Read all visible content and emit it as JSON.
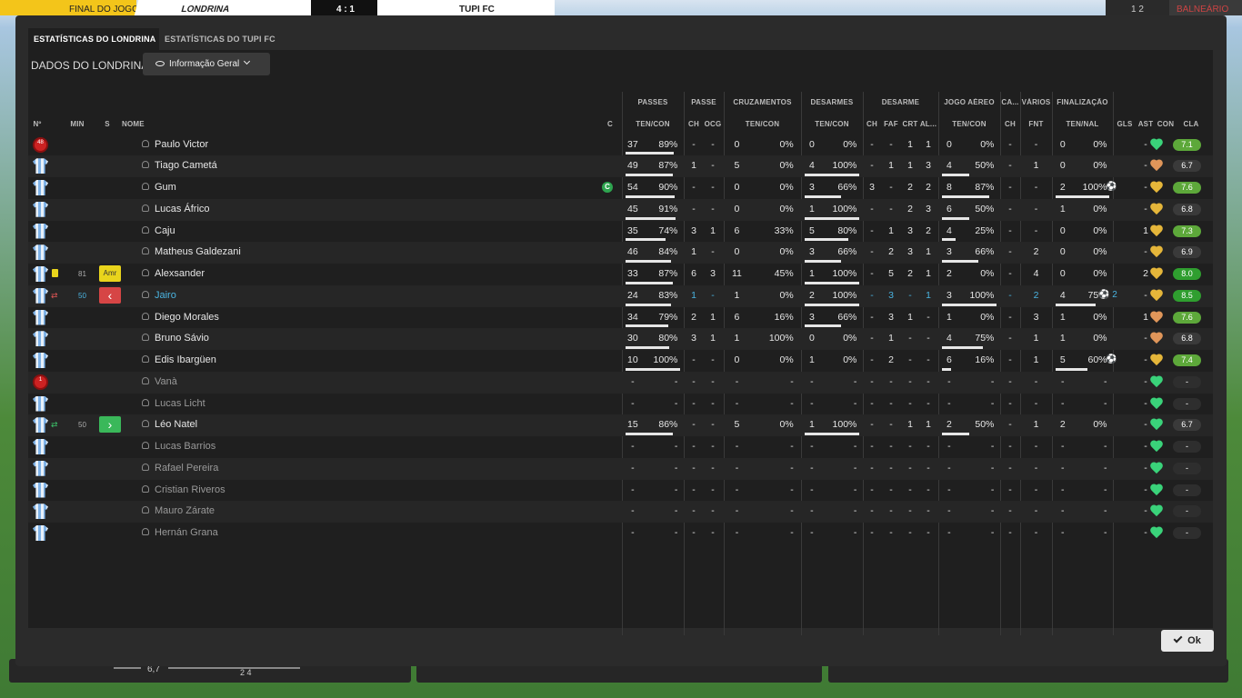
{
  "topbar": {
    "status": "FINAL DO JOGO",
    "home_team": "LONDRINA",
    "score": "4 : 1",
    "away_team": "TUPI FC",
    "controls": "1 2",
    "vestiario": "BALNEÁRIO"
  },
  "underlay": {
    "rating": "6,7",
    "value": "2 4"
  },
  "tabs": [
    {
      "label": "ESTATÍSTICAS DO LONDRINA",
      "active": true
    },
    {
      "label": "ESTATÍSTICAS DO TUPI FC",
      "active": false
    }
  ],
  "toolbar": {
    "label": "DADOS DO LONDRINA",
    "view": "Informação Geral"
  },
  "groups": [
    "PASSES",
    "PASSE",
    "CRUZAMENTOS",
    "DESARMES",
    "DESARME",
    "JOGO AÉREO",
    "CA...",
    "VÁRIOS",
    "FINALIZAÇÃO"
  ],
  "columns": {
    "num": "Nº",
    "min": "MIN",
    "s": "S",
    "name": "NOME",
    "c": "C",
    "passes": "TEN/CON",
    "pch": "CH",
    "pocg": "OCG",
    "cross": "TEN/CON",
    "tackles": "TEN/CON",
    "dch": "CH",
    "faf": "FAF",
    "crt": "CRT",
    "al": "AL...",
    "air": "TEN/CON",
    "cach": "CH",
    "fnt": "FNT",
    "shots": "TEN/NAL",
    "gls": "GLS",
    "ast": "AST",
    "con": "CON",
    "cla": "CLA"
  },
  "colors": {
    "rating_high": "#5da83a",
    "rating_top": "#2f9e2f",
    "rating_neutral": "#3a3a3a",
    "heart_green": "#3ad37a",
    "heart_gold": "#e5b63a",
    "heart_orange": "#e0965a",
    "link_blue": "#4ab3e0"
  },
  "players": [
    {
      "shirt": "gk",
      "num": "48",
      "name": "Paulo Victor",
      "cap": "",
      "pass": [
        "37",
        "89%"
      ],
      "pch": "-",
      "pocg": "-",
      "cross": [
        "0",
        "0%"
      ],
      "tack": [
        "0",
        "0%"
      ],
      "dch": "-",
      "faf": "-",
      "crt": "1",
      "al": "1",
      "air": [
        "0",
        "0%"
      ],
      "cach": "-",
      "fnt": "-",
      "shot": [
        "0",
        "0%"
      ],
      "gls": "",
      "ast": "-",
      "con": "green",
      "cla": "7.1",
      "cla_c": "green",
      "pass_fill": 0.89,
      "tack_fill": 0,
      "air_fill": 0,
      "shot_fill": 0
    },
    {
      "shirt": "out",
      "num": "",
      "name": "Tiago Cametá",
      "cap": "",
      "pass": [
        "49",
        "87%"
      ],
      "pch": "1",
      "pocg": "-",
      "cross": [
        "5",
        "0%"
      ],
      "tack": [
        "4",
        "100%"
      ],
      "dch": "-",
      "faf": "1",
      "crt": "1",
      "al": "3",
      "air": [
        "4",
        "50%"
      ],
      "cach": "-",
      "fnt": "1",
      "shot": [
        "0",
        "0%"
      ],
      "gls": "",
      "ast": "-",
      "con": "orange",
      "cla": "6.7",
      "cla_c": "neutral",
      "pass_fill": 0.87,
      "tack_fill": 1,
      "air_fill": 0.5,
      "shot_fill": 0
    },
    {
      "shirt": "out",
      "num": "",
      "name": "Gum",
      "cap": "C",
      "pass": [
        "54",
        "90%"
      ],
      "pch": "-",
      "pocg": "-",
      "cross": [
        "0",
        "0%"
      ],
      "tack": [
        "3",
        "66%"
      ],
      "dch": "3",
      "faf": "-",
      "crt": "2",
      "al": "2",
      "air": [
        "8",
        "87%"
      ],
      "cach": "-",
      "fnt": "-",
      "shot": [
        "2",
        "100%"
      ],
      "gls": "ball",
      "ast": "-",
      "con": "gold",
      "cla": "7.6",
      "cla_c": "green",
      "pass_fill": 0.9,
      "tack_fill": 0.66,
      "air_fill": 0.87,
      "shot_fill": 1
    },
    {
      "shirt": "out",
      "num": "",
      "name": "Lucas Áfrico",
      "cap": "",
      "pass": [
        "45",
        "91%"
      ],
      "pch": "-",
      "pocg": "-",
      "cross": [
        "0",
        "0%"
      ],
      "tack": [
        "1",
        "100%"
      ],
      "dch": "-",
      "faf": "-",
      "crt": "2",
      "al": "3",
      "air": [
        "6",
        "50%"
      ],
      "cach": "-",
      "fnt": "-",
      "shot": [
        "1",
        "0%"
      ],
      "gls": "",
      "ast": "-",
      "con": "gold",
      "cla": "6.8",
      "cla_c": "neutral",
      "pass_fill": 0.91,
      "tack_fill": 1,
      "air_fill": 0.5,
      "shot_fill": 0
    },
    {
      "shirt": "out",
      "num": "",
      "name": "Caju",
      "cap": "",
      "pass": [
        "35",
        "74%"
      ],
      "pch": "3",
      "pocg": "1",
      "cross": [
        "6",
        "33%"
      ],
      "tack": [
        "5",
        "80%"
      ],
      "dch": "-",
      "faf": "1",
      "crt": "3",
      "al": "2",
      "air": [
        "4",
        "25%"
      ],
      "cach": "-",
      "fnt": "-",
      "shot": [
        "0",
        "0%"
      ],
      "gls": "",
      "ast": "1",
      "con": "gold",
      "cla": "7.3",
      "cla_c": "green",
      "pass_fill": 0.74,
      "tack_fill": 0.8,
      "air_fill": 0.25,
      "shot_fill": 0
    },
    {
      "shirt": "out",
      "num": "",
      "name": "Matheus Galdezani",
      "cap": "",
      "pass": [
        "46",
        "84%"
      ],
      "pch": "1",
      "pocg": "-",
      "cross": [
        "0",
        "0%"
      ],
      "tack": [
        "3",
        "66%"
      ],
      "dch": "-",
      "faf": "2",
      "crt": "3",
      "al": "1",
      "air": [
        "3",
        "66%"
      ],
      "cach": "-",
      "fnt": "2",
      "shot": [
        "0",
        "0%"
      ],
      "gls": "",
      "ast": "-",
      "con": "gold",
      "cla": "6.9",
      "cla_c": "neutral",
      "pass_fill": 0.84,
      "tack_fill": 0.66,
      "air_fill": 0.66,
      "shot_fill": 0
    },
    {
      "shirt": "out",
      "num": "",
      "name": "Alexsander",
      "cap": "",
      "card": "yellow",
      "min": "81",
      "badge": "Amr",
      "pass": [
        "33",
        "87%"
      ],
      "pch": "6",
      "pocg": "3",
      "cross": [
        "11",
        "45%"
      ],
      "tack": [
        "1",
        "100%"
      ],
      "dch": "-",
      "faf": "5",
      "crt": "2",
      "al": "1",
      "air": [
        "2",
        "0%"
      ],
      "cach": "-",
      "fnt": "4",
      "shot": [
        "0",
        "0%"
      ],
      "gls": "",
      "ast": "2",
      "con": "gold",
      "cla": "8.0",
      "cla_c": "top",
      "pass_fill": 0.87,
      "tack_fill": 1,
      "air_fill": 0,
      "shot_fill": 0
    },
    {
      "shirt": "out",
      "num": "",
      "name": "Jairo",
      "cap": "",
      "sub": "off",
      "min": "50",
      "badge": "‹",
      "hl": true,
      "pass": [
        "24",
        "83%"
      ],
      "pch": "1",
      "pocg": "-",
      "cross": [
        "1",
        "0%"
      ],
      "tack": [
        "2",
        "100%"
      ],
      "dch": "-",
      "faf": "3",
      "crt": "-",
      "al": "1",
      "air": [
        "3",
        "100%"
      ],
      "cach": "-",
      "fnt": "2",
      "shot": [
        "4",
        "75%"
      ],
      "gls": "ball2",
      "ast": "-",
      "con": "gold",
      "cla": "8.5",
      "cla_c": "top",
      "pass_fill": 0.83,
      "tack_fill": 1,
      "air_fill": 1,
      "shot_fill": 0.75
    },
    {
      "shirt": "out",
      "num": "",
      "name": "Diego Morales",
      "cap": "",
      "pass": [
        "34",
        "79%"
      ],
      "pch": "2",
      "pocg": "1",
      "cross": [
        "6",
        "16%"
      ],
      "tack": [
        "3",
        "66%"
      ],
      "dch": "-",
      "faf": "3",
      "crt": "1",
      "al": "-",
      "air": [
        "1",
        "0%"
      ],
      "cach": "-",
      "fnt": "3",
      "shot": [
        "1",
        "0%"
      ],
      "gls": "",
      "ast": "1",
      "con": "orange",
      "cla": "7.6",
      "cla_c": "green",
      "pass_fill": 0.79,
      "tack_fill": 0.66,
      "air_fill": 0,
      "shot_fill": 0
    },
    {
      "shirt": "out",
      "num": "",
      "name": "Bruno Sávio",
      "cap": "",
      "pass": [
        "30",
        "80%"
      ],
      "pch": "3",
      "pocg": "1",
      "cross": [
        "1",
        "100%"
      ],
      "tack": [
        "0",
        "0%"
      ],
      "dch": "-",
      "faf": "1",
      "crt": "-",
      "al": "-",
      "air": [
        "4",
        "75%"
      ],
      "cach": "-",
      "fnt": "1",
      "shot": [
        "1",
        "0%"
      ],
      "gls": "",
      "ast": "-",
      "con": "orange",
      "cla": "6.8",
      "cla_c": "neutral",
      "pass_fill": 0.8,
      "tack_fill": 0,
      "air_fill": 0.75,
      "shot_fill": 0
    },
    {
      "shirt": "out",
      "num": "",
      "name": "Edis Ibargüen",
      "cap": "",
      "pass": [
        "10",
        "100%"
      ],
      "pch": "-",
      "pocg": "-",
      "cross": [
        "0",
        "0%"
      ],
      "tack": [
        "1",
        "0%"
      ],
      "dch": "-",
      "faf": "2",
      "crt": "-",
      "al": "-",
      "air": [
        "6",
        "16%"
      ],
      "cach": "-",
      "fnt": "1",
      "shot": [
        "5",
        "60%"
      ],
      "gls": "ball",
      "ast": "-",
      "con": "gold",
      "cla": "7.4",
      "cla_c": "green",
      "pass_fill": 1,
      "tack_fill": 0,
      "air_fill": 0.16,
      "shot_fill": 0.6
    },
    {
      "shirt": "gk",
      "num": "1",
      "name": "Vanà",
      "cap": "",
      "dim": true,
      "pass": [
        "-",
        "-"
      ],
      "pch": "-",
      "pocg": "-",
      "cross": [
        "-",
        "-"
      ],
      "tack": [
        "-",
        "-"
      ],
      "dch": "-",
      "faf": "-",
      "crt": "-",
      "al": "-",
      "air": [
        "-",
        "-"
      ],
      "cach": "-",
      "fnt": "-",
      "shot": [
        "-",
        "-"
      ],
      "gls": "",
      "ast": "-",
      "con": "green",
      "cla": "-",
      "cla_c": "dark"
    },
    {
      "shirt": "out",
      "num": "",
      "name": "Lucas Licht",
      "cap": "",
      "dim": true,
      "pass": [
        "-",
        "-"
      ],
      "pch": "-",
      "pocg": "-",
      "cross": [
        "-",
        "-"
      ],
      "tack": [
        "-",
        "-"
      ],
      "dch": "-",
      "faf": "-",
      "crt": "-",
      "al": "-",
      "air": [
        "-",
        "-"
      ],
      "cach": "-",
      "fnt": "-",
      "shot": [
        "-",
        "-"
      ],
      "gls": "",
      "ast": "-",
      "con": "green",
      "cla": "-",
      "cla_c": "dark"
    },
    {
      "shirt": "out",
      "num": "",
      "name": "Léo Natel",
      "cap": "",
      "sub": "on",
      "min": "50",
      "badge": "›",
      "pass": [
        "15",
        "86%"
      ],
      "pch": "-",
      "pocg": "-",
      "cross": [
        "5",
        "0%"
      ],
      "tack": [
        "1",
        "100%"
      ],
      "dch": "-",
      "faf": "-",
      "crt": "1",
      "al": "1",
      "air": [
        "2",
        "50%"
      ],
      "cach": "-",
      "fnt": "1",
      "shot": [
        "2",
        "0%"
      ],
      "gls": "",
      "ast": "-",
      "con": "green",
      "cla": "6.7",
      "cla_c": "neutral",
      "pass_fill": 0.86,
      "tack_fill": 1,
      "air_fill": 0.5,
      "shot_fill": 0
    },
    {
      "shirt": "out",
      "num": "",
      "name": "Lucas Barrios",
      "cap": "",
      "dim": true,
      "pass": [
        "-",
        "-"
      ],
      "pch": "-",
      "pocg": "-",
      "cross": [
        "-",
        "-"
      ],
      "tack": [
        "-",
        "-"
      ],
      "dch": "-",
      "faf": "-",
      "crt": "-",
      "al": "-",
      "air": [
        "-",
        "-"
      ],
      "cach": "-",
      "fnt": "-",
      "shot": [
        "-",
        "-"
      ],
      "gls": "",
      "ast": "-",
      "con": "green",
      "cla": "-",
      "cla_c": "dark"
    },
    {
      "shirt": "out",
      "num": "",
      "name": "Rafael Pereira",
      "cap": "",
      "dim": true,
      "pass": [
        "-",
        "-"
      ],
      "pch": "-",
      "pocg": "-",
      "cross": [
        "-",
        "-"
      ],
      "tack": [
        "-",
        "-"
      ],
      "dch": "-",
      "faf": "-",
      "crt": "-",
      "al": "-",
      "air": [
        "-",
        "-"
      ],
      "cach": "-",
      "fnt": "-",
      "shot": [
        "-",
        "-"
      ],
      "gls": "",
      "ast": "-",
      "con": "green",
      "cla": "-",
      "cla_c": "dark"
    },
    {
      "shirt": "out",
      "num": "",
      "name": "Cristian Riveros",
      "cap": "",
      "dim": true,
      "pass": [
        "-",
        "-"
      ],
      "pch": "-",
      "pocg": "-",
      "cross": [
        "-",
        "-"
      ],
      "tack": [
        "-",
        "-"
      ],
      "dch": "-",
      "faf": "-",
      "crt": "-",
      "al": "-",
      "air": [
        "-",
        "-"
      ],
      "cach": "-",
      "fnt": "-",
      "shot": [
        "-",
        "-"
      ],
      "gls": "",
      "ast": "-",
      "con": "green",
      "cla": "-",
      "cla_c": "dark"
    },
    {
      "shirt": "out",
      "num": "",
      "name": "Mauro Zárate",
      "cap": "",
      "dim": true,
      "pass": [
        "-",
        "-"
      ],
      "pch": "-",
      "pocg": "-",
      "cross": [
        "-",
        "-"
      ],
      "tack": [
        "-",
        "-"
      ],
      "dch": "-",
      "faf": "-",
      "crt": "-",
      "al": "-",
      "air": [
        "-",
        "-"
      ],
      "cach": "-",
      "fnt": "-",
      "shot": [
        "-",
        "-"
      ],
      "gls": "",
      "ast": "-",
      "con": "green",
      "cla": "-",
      "cla_c": "dark"
    },
    {
      "shirt": "out",
      "num": "",
      "name": "Hernán Grana",
      "cap": "",
      "dim": true,
      "pass": [
        "-",
        "-"
      ],
      "pch": "-",
      "pocg": "-",
      "cross": [
        "-",
        "-"
      ],
      "tack": [
        "-",
        "-"
      ],
      "dch": "-",
      "faf": "-",
      "crt": "-",
      "al": "-",
      "air": [
        "-",
        "-"
      ],
      "cach": "-",
      "fnt": "-",
      "shot": [
        "-",
        "-"
      ],
      "gls": "",
      "ast": "-",
      "con": "green",
      "cla": "-",
      "cla_c": "dark"
    }
  ],
  "footer": {
    "ok": "Ok"
  }
}
